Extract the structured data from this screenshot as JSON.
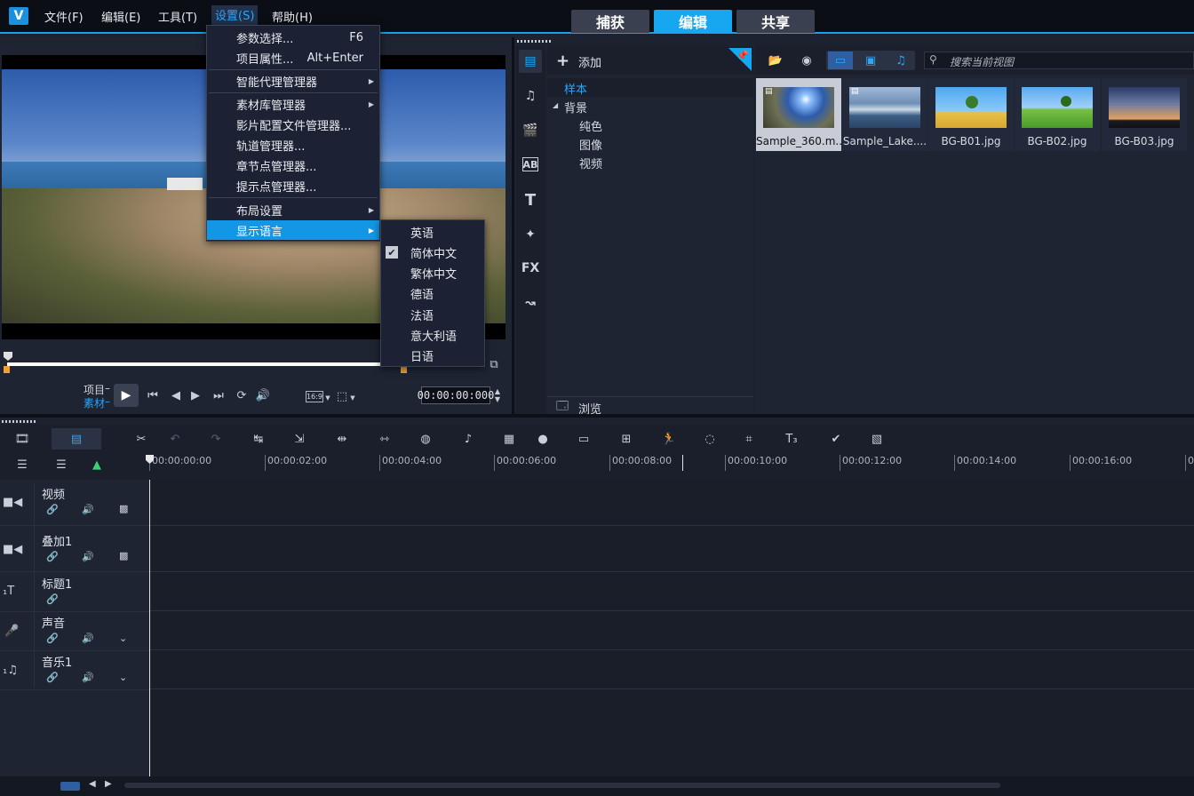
{
  "menubar": {
    "logo": "V",
    "items": [
      "文件(F)",
      "编辑(E)",
      "工具(T)",
      "设置(S)",
      "帮助(H)"
    ]
  },
  "top_tabs": [
    "捕获",
    "编辑",
    "共享"
  ],
  "settings_menu": {
    "items": [
      {
        "label": "参数选择...",
        "shortcut": "F6"
      },
      {
        "label": "项目属性...",
        "shortcut": "Alt+Enter"
      },
      {
        "label": "智能代理管理器"
      },
      {
        "label": "素材库管理器"
      },
      {
        "label": "影片配置文件管理器..."
      },
      {
        "label": "轨道管理器..."
      },
      {
        "label": "章节点管理器..."
      },
      {
        "label": "提示点管理器..."
      },
      {
        "label": "布局设置"
      },
      {
        "label": "显示语言"
      }
    ]
  },
  "language_submenu": {
    "items": [
      "英语",
      "简体中文",
      "繁体中文",
      "德语",
      "法语",
      "意大利语",
      "日语"
    ],
    "checked": "简体中文",
    "check_mark": "✔"
  },
  "player": {
    "mode_project": "项目",
    "mode_clip": "素材",
    "aspect": "16:9",
    "timecode": "00:00:00:000"
  },
  "library": {
    "add_label": "添加",
    "browse_label": "浏览",
    "search_placeholder": "搜索当前视图",
    "tree": {
      "root": "样本",
      "group": "背景",
      "children": [
        "纯色",
        "图像",
        "视频"
      ]
    },
    "thumbnails": [
      "Sample_360.m...",
      "Sample_Lake....",
      "BG-B01.jpg",
      "BG-B02.jpg",
      "BG-B03.jpg"
    ],
    "left_icons": [
      "media-icon",
      "audio-icon",
      "instant-project-icon",
      "transition-icon",
      "title-icon",
      "graphics-icon",
      "fx-icon",
      "motion-path-icon"
    ],
    "fx_label": "FX",
    "ab_label": "AB",
    "t_label": "T"
  },
  "timeline": {
    "ruler": [
      "00:00:00:00",
      "00:00:02:00",
      "00:00:04:00",
      "00:00:06:00",
      "00:00:08:00",
      "00:00:10:00",
      "00:00:12:00",
      "00:00:14:00",
      "00:00:16:00",
      "00"
    ],
    "tracks": [
      {
        "name": "视频",
        "icon": "video-track-icon"
      },
      {
        "name": "叠加1",
        "icon": "overlay-track-icon"
      },
      {
        "name": "标题1",
        "icon": "title-track-icon"
      },
      {
        "name": "声音",
        "icon": "voice-track-icon"
      },
      {
        "name": "音乐1",
        "icon": "music-track-icon"
      }
    ]
  },
  "colors": {
    "accent": "#17a6f0",
    "menu_highlight": "#1496e6",
    "background": "#1d2230"
  }
}
